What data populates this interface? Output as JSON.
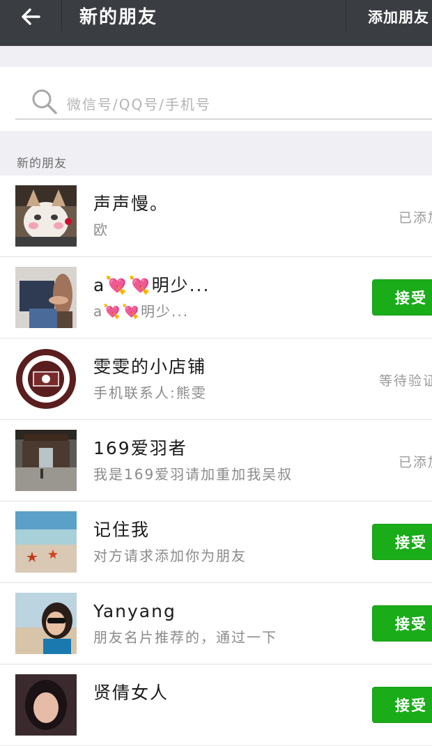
{
  "header": {
    "title": "新的朋友",
    "add_label": "添加朋友"
  },
  "search": {
    "placeholder": "微信号/QQ号/手机号"
  },
  "section": {
    "label": "新的朋友"
  },
  "accept_label": "接受",
  "friends": [
    {
      "name": "声声慢。",
      "message": "欧",
      "status": "已添加",
      "avatar_icon": "cat-photo"
    },
    {
      "name": "a💘💘明少...",
      "message": "a💘💘明少...",
      "status": "接受",
      "avatar_icon": "person-photo"
    },
    {
      "name": "雯雯的小店铺",
      "message": "手机联系人:熊雯",
      "status": "等待验证",
      "avatar_icon": "shop-logo"
    },
    {
      "name": "169爱羽者",
      "message": "我是169爱羽请加重加我吴叔",
      "status": "已添加",
      "avatar_icon": "street-photo"
    },
    {
      "name": "记住我",
      "message": "对方请求添加你为朋友",
      "status": "接受",
      "avatar_icon": "beach-photo"
    },
    {
      "name": "Yanyang",
      "message": "朋友名片推荐的，通过一下",
      "status": "接受",
      "avatar_icon": "selfie-photo"
    },
    {
      "name": "贤倩女人",
      "message": "",
      "status": "接受",
      "avatar_icon": "portrait-photo"
    }
  ],
  "colors": {
    "topbar": "#3a3d42",
    "accept_button": "#1aad19",
    "background": "#efeff4"
  }
}
